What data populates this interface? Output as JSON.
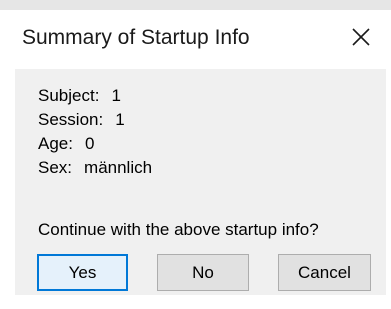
{
  "dialog": {
    "title": "Summary of Startup Info",
    "close_icon": "close-icon",
    "fields": [
      {
        "label": "Subject:",
        "value": "1"
      },
      {
        "label": "Session:",
        "value": "1"
      },
      {
        "label": "Age:",
        "value": "0"
      },
      {
        "label": "Sex:",
        "value": "männlich"
      }
    ],
    "question": "Continue with the above startup info?",
    "buttons": {
      "yes": "Yes",
      "no": "No",
      "cancel": "Cancel"
    }
  },
  "colors": {
    "default_button_border": "#0078d7",
    "default_button_fill": "#e5f1fb",
    "button_fill": "#e1e1e1",
    "client_background": "#f0f0f0"
  }
}
